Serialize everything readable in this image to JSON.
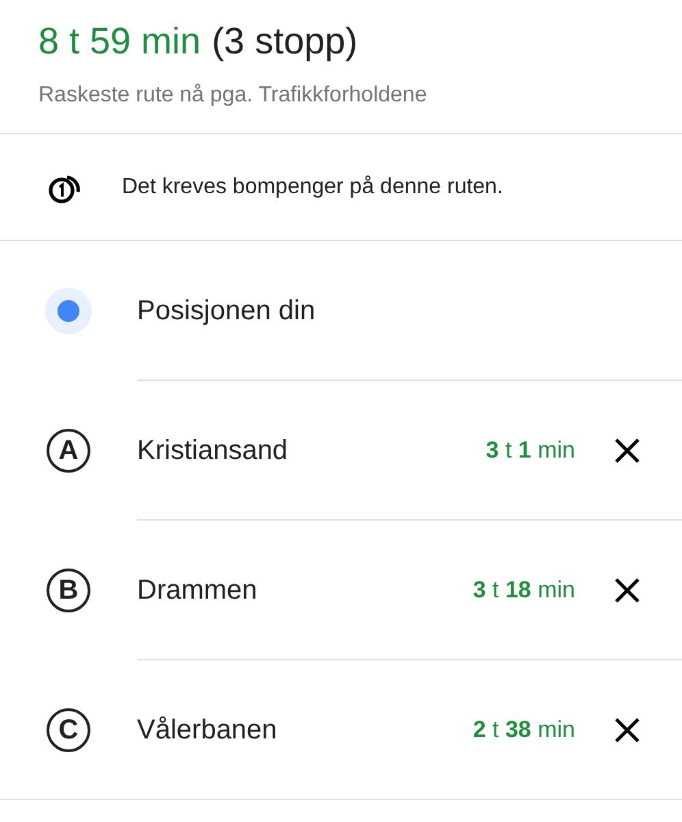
{
  "summary": {
    "duration": "8 t 59 min",
    "stops": "(3 stopp)",
    "subtitle": "Raskeste rute nå pga. Trafikkforholdene"
  },
  "notice": {
    "text": "Det kreves bompenger på denne ruten."
  },
  "route": [
    {
      "kind": "origin",
      "name": "Posisjonen din"
    },
    {
      "kind": "waypoint",
      "marker": "A",
      "name": "Kristiansand",
      "time": "**3** t **1** min"
    },
    {
      "kind": "waypoint",
      "marker": "B",
      "name": "Drammen",
      "time": "**3** t **18** min"
    },
    {
      "kind": "waypoint",
      "marker": "C",
      "name": "Vålerbanen",
      "time": "**2** t **38** min"
    }
  ]
}
